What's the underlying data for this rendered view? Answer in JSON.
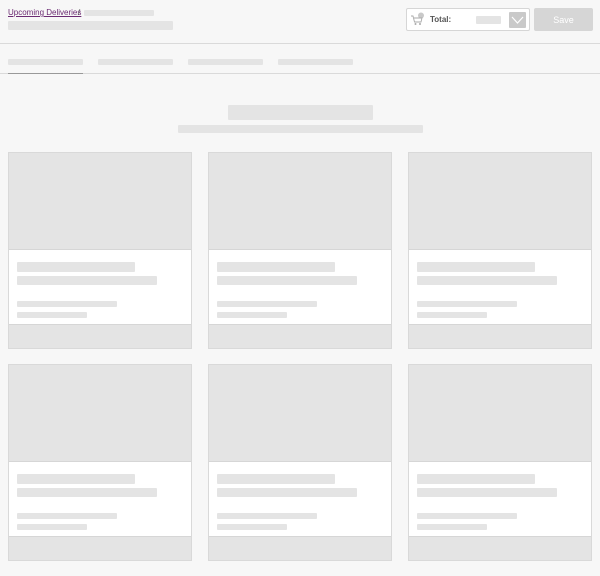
{
  "breadcrumb": {
    "link_label": "Upcoming Deliveries",
    "separator": "/"
  },
  "cart_total": {
    "label": "Total:",
    "icon": "cart-icon"
  },
  "save_label": "Save",
  "colors": {
    "link": "#6b2a72",
    "skeleton": "#e4e4e4",
    "background": "#f7f7f7"
  },
  "tab_count": 4,
  "product_card_count": 6
}
